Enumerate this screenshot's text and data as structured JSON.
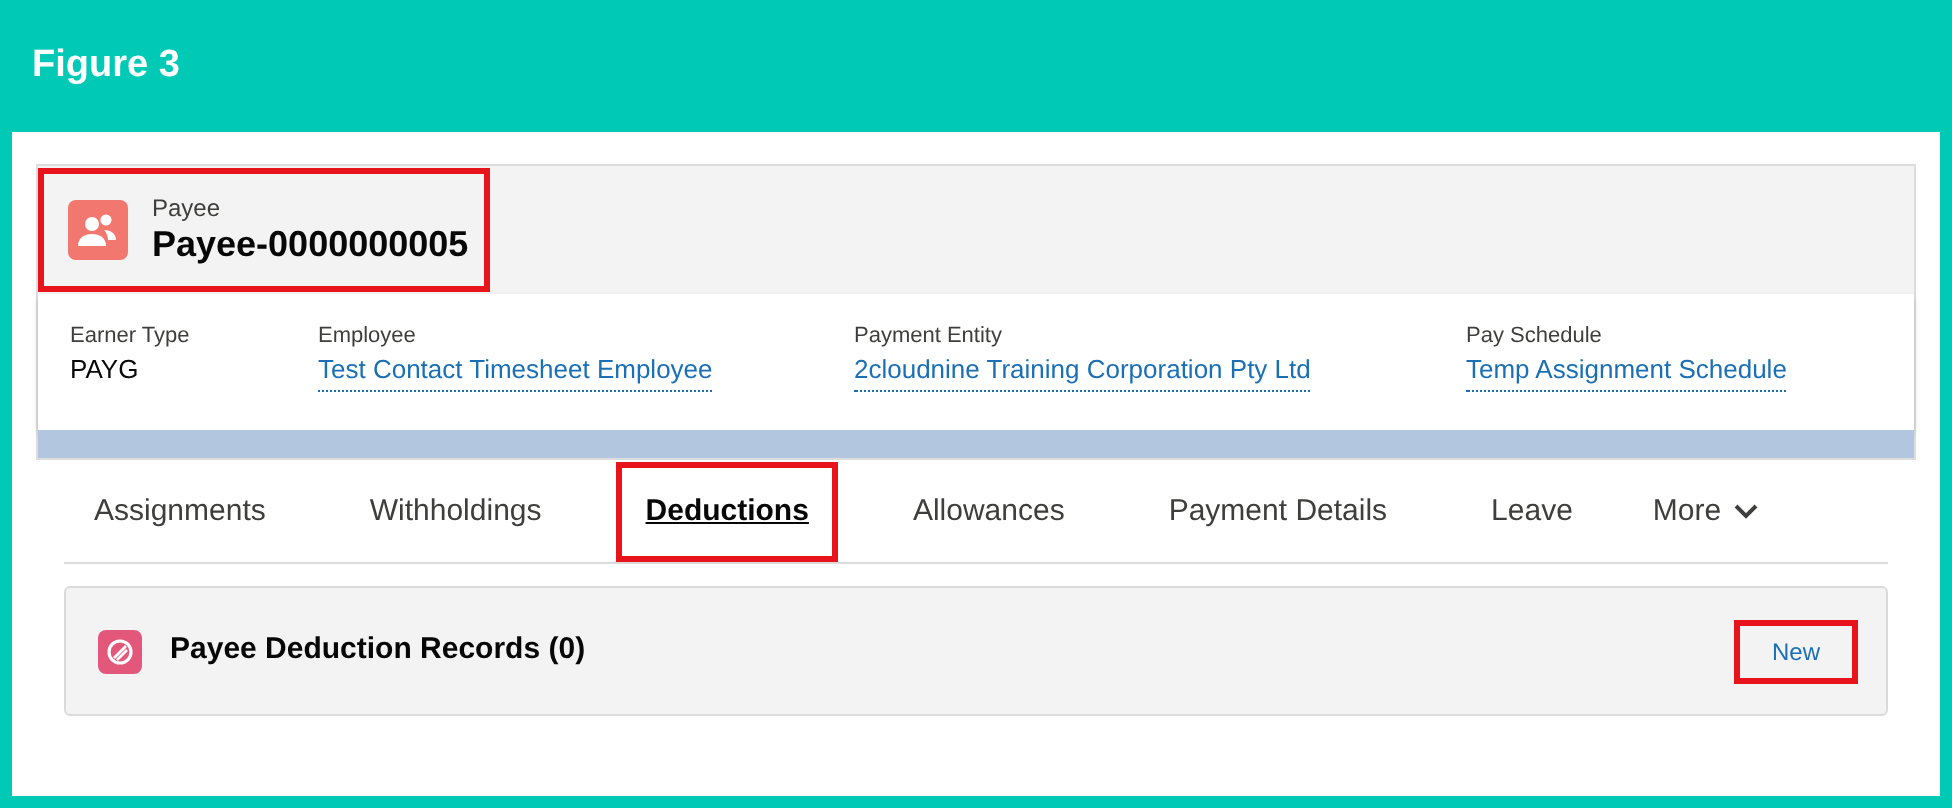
{
  "figure": {
    "title": "Figure 3"
  },
  "header": {
    "object_label": "Payee",
    "record_name": "Payee-0000000005",
    "highlighted": true
  },
  "fields": [
    {
      "label": "Earner Type",
      "value": "PAYG",
      "kind": "text"
    },
    {
      "label": "Employee",
      "value": "Test Contact Timesheet Employee",
      "kind": "link"
    },
    {
      "label": "Payment Entity",
      "value": "2cloudnine Training Corporation Pty Ltd",
      "kind": "link"
    },
    {
      "label": "Pay Schedule",
      "value": "Temp Assignment Schedule",
      "kind": "link"
    }
  ],
  "tabs": [
    {
      "label": "Assignments",
      "selected": false,
      "highlighted": false
    },
    {
      "label": "Withholdings",
      "selected": false,
      "highlighted": false
    },
    {
      "label": "Deductions",
      "selected": true,
      "highlighted": true
    },
    {
      "label": "Allowances",
      "selected": false,
      "highlighted": false
    },
    {
      "label": "Payment Details",
      "selected": false,
      "highlighted": false
    },
    {
      "label": "Leave",
      "selected": false,
      "highlighted": false
    }
  ],
  "more_tab": {
    "label": "More"
  },
  "related_list": {
    "title": "Payee Deduction Records (0)",
    "new_button": {
      "label": "New",
      "highlighted": true
    }
  }
}
